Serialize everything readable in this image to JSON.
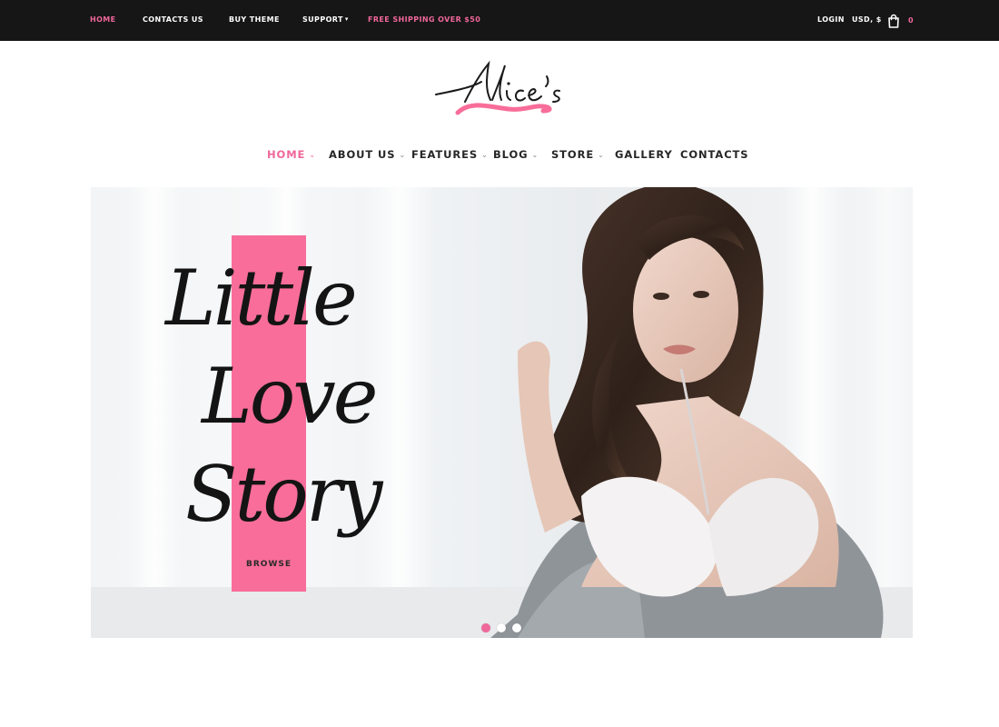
{
  "topbar": {
    "items": [
      {
        "label": "HOME",
        "active": true
      },
      {
        "label": "CONTACTS US"
      },
      {
        "label": "BUY THEME"
      },
      {
        "label": "SUPPORT"
      }
    ],
    "promo": "FREE SHIPPING OVER $50",
    "login": "LOGIN",
    "currency": "USD, $",
    "cart_count": "0",
    "cart_icon": "shopping-bag-icon"
  },
  "logo": {
    "text": "Alice's"
  },
  "nav": {
    "items": [
      {
        "label": "HOME",
        "active": true,
        "dropdown": true
      },
      {
        "label": "ABOUT US",
        "dropdown": true
      },
      {
        "label": "FEATURES",
        "dropdown": true
      },
      {
        "label": "BLOG",
        "dropdown": true
      },
      {
        "label": "STORE",
        "dropdown": true
      },
      {
        "label": "GALLERY",
        "dropdown": false
      },
      {
        "label": "CONTACTS",
        "dropdown": false
      }
    ]
  },
  "hero": {
    "title_lines": [
      "Little",
      "Love",
      "Story"
    ],
    "button": "BROWSE",
    "slides": 3,
    "active_slide": 1
  },
  "colors": {
    "accent": "#f0679a",
    "topbar_bg": "#161616",
    "pink_bar": "#f86d9a"
  }
}
